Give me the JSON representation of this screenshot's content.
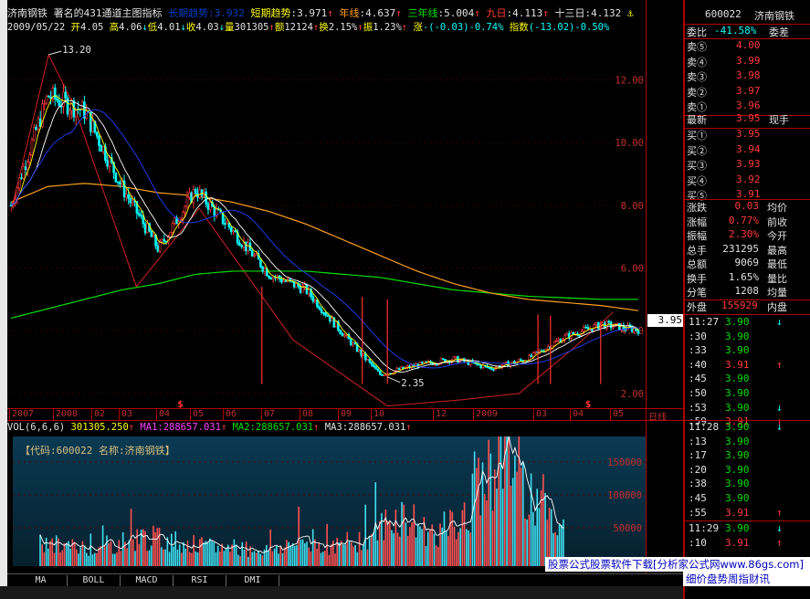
{
  "title_bar": {
    "stock_name": "济南钢铁",
    "indicator_name": "著名的431通道主图指标",
    "hidden_label": "长期趋势",
    "hidden_value": "3.932",
    "short_trend_label": "短期趋势",
    "short_trend_value": ":3.971",
    "year_line_label": "年线",
    "year_line_value": ":4.637",
    "three_year_label": "三年线",
    "three_year_value": ":5.004",
    "nine_day_label": "九日",
    "nine_day_value": ":4.113",
    "thirteen_day_label": "十三日",
    "thirteen_day_value": ":4.132"
  },
  "info_bar": {
    "date": "2009/05/22",
    "open_label": "开",
    "open_value": "4.05",
    "high_label": "高",
    "high_value": "4.06",
    "low_label": "低",
    "low_value": "4.01",
    "close_label": "收",
    "close_value": "4.03",
    "volume_label": "量",
    "volume_value": "301305",
    "amount_label": "额",
    "amount_value": "12124",
    "turnover_label": "换",
    "turnover_value": "2.15%",
    "amplitude_label": "振",
    "amplitude_value": "1.23%",
    "change_label": "涨",
    "change_value": "-(-0.03)-0.74%",
    "index_label": "指数",
    "index_value": "(-13.02)-0.50%"
  },
  "price_axis": {
    "ticks": [
      "12.00",
      "10.00",
      "8.00",
      "6.00",
      "4.00",
      "2.00"
    ]
  },
  "annotations": {
    "peak": "13.20",
    "trough": "2.35"
  },
  "date_axis": {
    "labels": [
      "2007",
      "2008",
      "02",
      "03",
      "04",
      "05",
      "06",
      "07",
      "08",
      "09",
      "10",
      "12",
      "2009",
      "03",
      "04",
      "05"
    ],
    "period": "日线"
  },
  "volume_header": {
    "title": "VOL(6,6,6)",
    "vol_value": "301305.250",
    "ma1_label": "MA1:",
    "ma1_value": "288657.031",
    "ma2_label": "MA2:",
    "ma2_value": "288657.031",
    "ma3_label": "MA3:",
    "ma3_value": "288657.031",
    "code_line": "【代码:600022 名称:济南钢铁】"
  },
  "volume_axis": {
    "ticks": [
      "150000",
      "100000",
      "50000"
    ]
  },
  "tabs": [
    "MA",
    "BOLL",
    "MACD",
    "RSI",
    "DMI"
  ],
  "right_panel": {
    "code": "600022",
    "name": "济南钢铁",
    "weibi_label": "委比",
    "weibi_value": "-41.58%",
    "weicha_label": "委差",
    "sell": [
      {
        "label": "卖⑤",
        "price": "4.00"
      },
      {
        "label": "卖④",
        "price": "3.99"
      },
      {
        "label": "卖③",
        "price": "3.98"
      },
      {
        "label": "卖②",
        "price": "3.97"
      },
      {
        "label": "卖①",
        "price": "3.96"
      }
    ],
    "latest_label": "最新",
    "latest_value": "3.95",
    "now_hand_label": "现手",
    "buy": [
      {
        "label": "买①",
        "price": "3.95"
      },
      {
        "label": "买②",
        "price": "3.94"
      },
      {
        "label": "买③",
        "price": "3.93"
      },
      {
        "label": "买④",
        "price": "3.92"
      },
      {
        "label": "买⑤",
        "price": "3.91"
      }
    ],
    "stats": [
      {
        "label": "涨跌",
        "value": "0.03",
        "label2": "均价"
      },
      {
        "label": "涨幅",
        "value": "0.77%",
        "label2": "前收"
      },
      {
        "label": "振幅",
        "value": "2.30%",
        "label2": "今开"
      },
      {
        "label": "总手",
        "value": "231295",
        "label2": "最高"
      },
      {
        "label": "总额",
        "value": "9069",
        "label2": "最低"
      },
      {
        "label": "换手",
        "value": "1.65%",
        "label2": "量比"
      },
      {
        "label": "分笔",
        "value": "1208",
        "label2": "均量"
      }
    ],
    "outer_label": "外盘",
    "outer_value": "155929",
    "inner_label": "内盘",
    "ticks_group1": [
      {
        "time": "11:27",
        "price": "3.90",
        "dir": "down"
      },
      {
        "time": ":30",
        "price": "3.90",
        "dir": ""
      },
      {
        "time": ":33",
        "price": "3.90",
        "dir": ""
      },
      {
        "time": ":40",
        "price": "3.91",
        "dir": "up"
      },
      {
        "time": ":45",
        "price": "3.90",
        "dir": ""
      },
      {
        "time": ":50",
        "price": "3.90",
        "dir": ""
      },
      {
        "time": ":53",
        "price": "3.90",
        "dir": "down"
      },
      {
        "time": ":59",
        "price": "3.91",
        "dir": "up"
      }
    ],
    "ticks_group2": [
      {
        "time": "11:28",
        "price": "3.90",
        "dir": "down"
      },
      {
        "time": ":13",
        "price": "3.90",
        "dir": ""
      },
      {
        "time": ":17",
        "price": "3.90",
        "dir": ""
      },
      {
        "time": ":20",
        "price": "3.90",
        "dir": ""
      },
      {
        "time": ":38",
        "price": "3.90",
        "dir": ""
      },
      {
        "time": ":45",
        "price": "3.90",
        "dir": ""
      },
      {
        "time": ":55",
        "price": "3.91",
        "dir": "up"
      }
    ],
    "ticks_group3": [
      {
        "time": "11:29",
        "price": "3.90",
        "dir": "down"
      },
      {
        "time": ":10",
        "price": "3.91",
        "dir": "up"
      }
    ]
  },
  "price_tag": "3.95",
  "watermark_line1": "股票公式股票软件下载[分析家公式网www.86gs.com]",
  "watermark_line2": "细价盘势周指财讯",
  "colors": {
    "up": "#ff3a3a",
    "down": "#00ffff",
    "grid_red": "#b00000",
    "ma_yellow": "#ffff00",
    "ma_orange": "#ffa020",
    "ma_green": "#00e000",
    "ma_blue": "#2040ff"
  },
  "chart_data": [
    {
      "type": "line",
      "title": "",
      "x": [
        "2007-12",
        "2008-01",
        "2008-02",
        "2008-03",
        "2008-04",
        "2008-05",
        "2008-06",
        "2008-07",
        "2008-08",
        "2008-09",
        "2008-10",
        "2008-11",
        "2008-12",
        "2009-01",
        "2009-02",
        "2009-03",
        "2009-04",
        "2009-05"
      ],
      "series": [
        {
          "name": "",
          "values": [
            8.0,
            11.5,
            11.0,
            8.6,
            6.6,
            8.5,
            7.2,
            5.8,
            5.3,
            3.9,
            2.6,
            2.9,
            3.1,
            2.8,
            3.1,
            3.8,
            4.2,
            4.03
          ]
        },
        {
          "name": "",
          "values": [
            8.1,
            8.6,
            8.7,
            8.6,
            8.4,
            8.3,
            8.1,
            7.8,
            7.4,
            6.9,
            6.4,
            5.9,
            5.5,
            5.2,
            5.0,
            4.9,
            4.8,
            4.64
          ]
        },
        {
          "name": "",
          "values": [
            4.4,
            4.7,
            5.0,
            5.3,
            5.5,
            5.8,
            5.9,
            5.9,
            5.9,
            5.8,
            5.7,
            5.5,
            5.3,
            5.2,
            5.1,
            5.05,
            5.0,
            5.0
          ]
        }
      ],
      "xlabel": "",
      "ylabel": "",
      "ylim": [
        1.5,
        13.5
      ],
      "annotations": [
        "13.20",
        "2.35"
      ]
    },
    {
      "type": "bar",
      "title": "VOL(6,6,6)",
      "categories": [
        "2008-01",
        "2008-02",
        "2008-03",
        "2008-04",
        "2008-05",
        "2008-06",
        "2008-07",
        "2008-08",
        "2008-09",
        "2008-10",
        "2008-11",
        "2008-12",
        "2009-01",
        "2009-02",
        "2009-03",
        "2009-04",
        "2009-05"
      ],
      "values": [
        35000,
        30000,
        28000,
        45000,
        40000,
        30000,
        28000,
        25000,
        38000,
        30000,
        45000,
        80000,
        50000,
        70000,
        180000,
        120000,
        60000
      ],
      "ylim": [
        0,
        190000
      ]
    }
  ]
}
